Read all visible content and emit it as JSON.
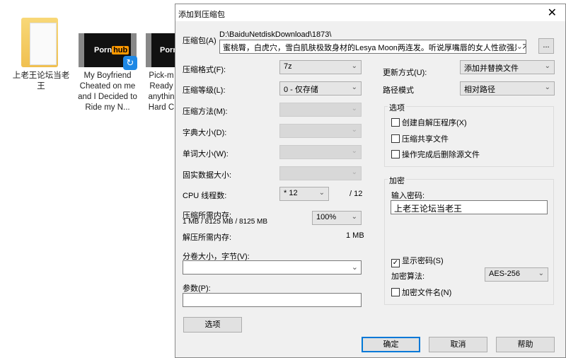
{
  "desktop": {
    "items": [
      {
        "label": "上老王论坛当老王",
        "type": "folder"
      },
      {
        "label": "My Boyfriend Cheated on me and I Decided to Ride my N...",
        "type": "video",
        "logo_a": "Porn",
        "logo_b": "hub"
      },
      {
        "label": "Pick-m Ready anythin Hard C",
        "type": "video",
        "logo_a": "Porn"
      }
    ]
  },
  "dialog": {
    "title": "添加到压缩包",
    "archive_label": "压缩包(A)",
    "archive_path": "D:\\BaiduNetdiskDownload\\1873\\",
    "archive_name": "蜜桃臀，白虎穴，雪白肌肤极致身材的Lesya Moon两连发。听说厚嘴唇的女人性欲强是不:",
    "browse": "...",
    "format_label": "压缩格式(F):",
    "format": "7z",
    "level_label": "压缩等级(L):",
    "level": "0 - 仅存储",
    "method_label": "压缩方法(M):",
    "dict_label": "字典大小(D):",
    "word_label": "单词大小(W):",
    "solid_label": "固实数据大小:",
    "cpu_label": "CPU 线程数:",
    "cpu": "* 12",
    "cpu_max": "/ 12",
    "mem_label": "压缩所需内存:",
    "mem_value": "1 MB / 8125 MB / 8125 MB",
    "mem_pct": "100%",
    "dmem_label": "解压所需内存:",
    "dmem_value": "1 MB",
    "split_label": "分卷大小，字节(V):",
    "split": "",
    "params_label": "参数(P):",
    "params": "",
    "options_btn": "选项",
    "update_label": "更新方式(U):",
    "update": "添加并替换文件",
    "path_label": "路径模式",
    "path": "相对路径",
    "options_group": "选项",
    "opt_sfx": "创建自解压程序(X)",
    "opt_shared": "压缩共享文件",
    "opt_delete": "操作完成后删除源文件",
    "enc_group": "加密",
    "pwd_label": "输入密码:",
    "pwd": "上老王论坛当老王",
    "show_pwd": "显示密码(S)",
    "enc_method_label": "加密算法:",
    "enc_method": "AES-256",
    "enc_names": "加密文件名(N)",
    "ok": "确定",
    "cancel": "取消",
    "help": "帮助"
  }
}
